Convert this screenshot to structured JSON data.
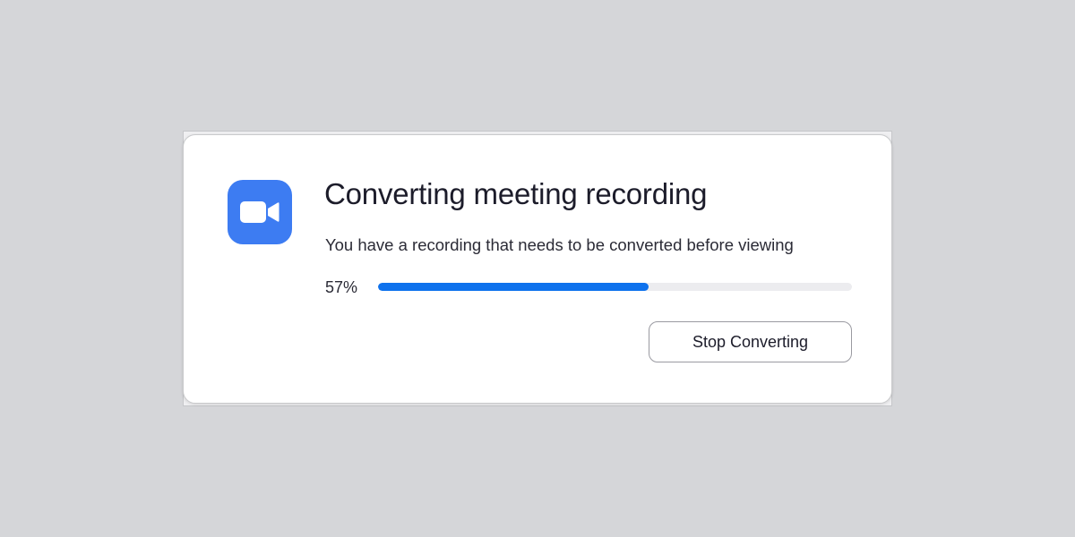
{
  "dialog": {
    "app_icon": "video-camera-icon",
    "title": "Converting meeting recording",
    "message": "You have a recording that needs to be converted before viewing",
    "progress": {
      "percent_label": "57%",
      "value": 0.57,
      "fill_color": "#0e72ed",
      "track_color": "#ececef"
    },
    "stop_button_label": "Stop Converting"
  },
  "colors": {
    "icon_background": "#3d7cf2",
    "background": "#d5d6d9"
  }
}
